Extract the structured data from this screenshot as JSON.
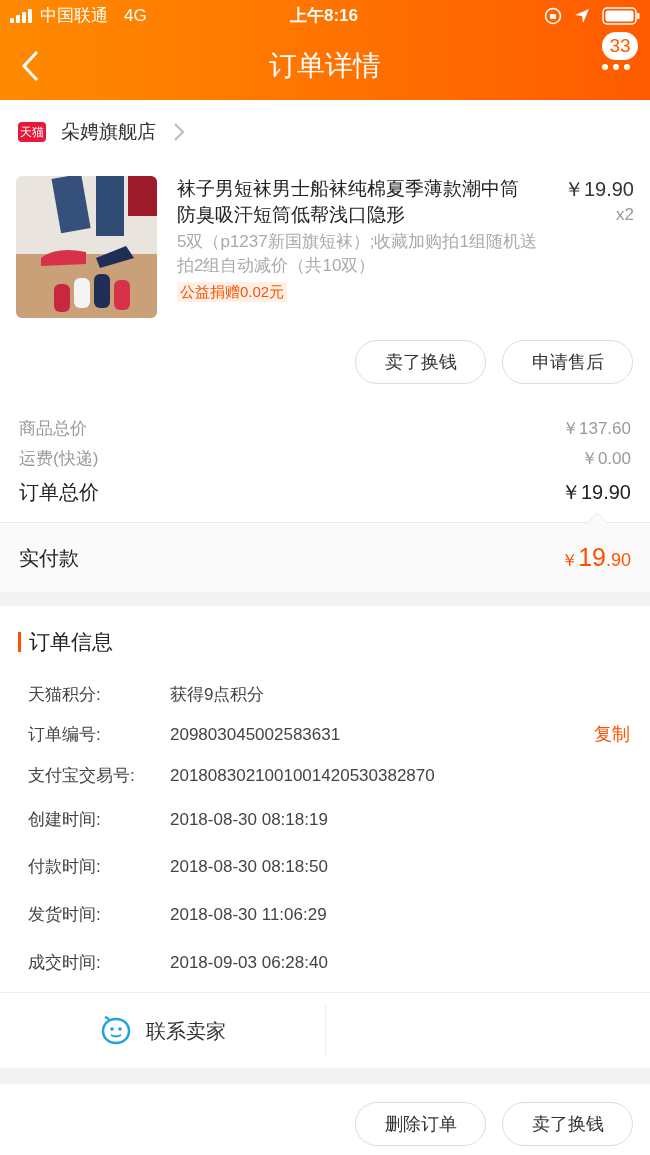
{
  "status_bar": {
    "carrier": "中国联通",
    "network": "4G",
    "time": "上午8:16"
  },
  "nav": {
    "title": "订单详情",
    "badge": "33"
  },
  "store": {
    "badge": "天猫",
    "name": "朵娉旗舰店"
  },
  "product": {
    "title": "袜子男短袜男士船袜纯棉夏季薄款潮中筒防臭吸汗短筒低帮浅口隐形",
    "price": "￥19.90",
    "quantity": "x2",
    "spec": "5双（p1237新国旗短袜）;收藏加购拍1组随机送拍2组自动减价（共10双）",
    "donation": "公益捐赠0.02元"
  },
  "item_buttons": [
    "卖了换钱",
    "申请售后"
  ],
  "summary": [
    {
      "label": "商品总价",
      "value": "￥137.60",
      "kind": "minor"
    },
    {
      "label": "运费(快递)",
      "value": "￥0.00",
      "kind": "minor"
    },
    {
      "label": "订单总价",
      "value": "￥19.90",
      "kind": "major"
    }
  ],
  "paid": {
    "label": "实付款",
    "currency": "￥",
    "integer": "19",
    "decimal": ".90"
  },
  "order_info": {
    "title": "订单信息",
    "rows": [
      {
        "label": "天猫积分:",
        "value": "获得9点积分"
      },
      {
        "label": "订单编号:",
        "value": "209803045002583631",
        "action": "复制"
      },
      {
        "label": "支付宝交易号:",
        "value": "2018083021001001420530382870"
      },
      {
        "label": "创建时间:",
        "value": "2018-08-30 08:18:19"
      },
      {
        "label": "付款时间:",
        "value": "2018-08-30 08:18:50"
      },
      {
        "label": "发货时间:",
        "value": "2018-08-30 11:06:29"
      },
      {
        "label": "成交时间:",
        "value": "2018-09-03 06:28:40"
      }
    ]
  },
  "contact": {
    "label": "联系卖家"
  },
  "bottom_buttons": [
    "删除订单",
    "卖了换钱"
  ]
}
